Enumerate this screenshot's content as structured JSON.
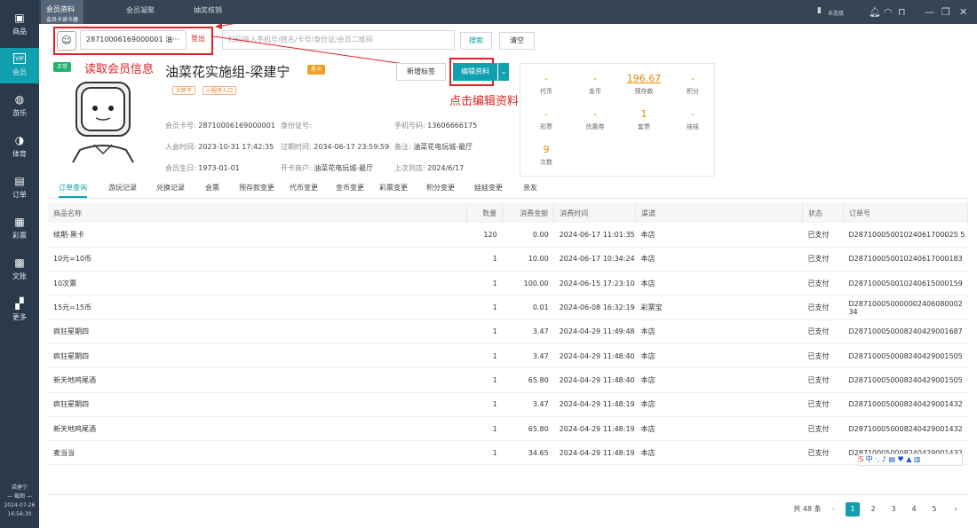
{
  "sidebar": {
    "items": [
      {
        "icon": "▣",
        "label": "商品",
        "name": "sidebar-item-goods"
      },
      {
        "icon": "VIP",
        "label": "会员",
        "name": "sidebar-item-member",
        "active": true
      },
      {
        "icon": "◍",
        "label": "游乐",
        "name": "sidebar-item-amusement"
      },
      {
        "icon": "◑",
        "label": "体育",
        "name": "sidebar-item-sports"
      },
      {
        "icon": "▤",
        "label": "订单",
        "name": "sidebar-item-orders"
      },
      {
        "icon": "▦",
        "label": "彩票",
        "name": "sidebar-item-lottery"
      },
      {
        "icon": "▩",
        "label": "文账",
        "name": "sidebar-item-accounts"
      },
      {
        "icon": "▞",
        "label": "更多",
        "name": "sidebar-item-more"
      }
    ],
    "user": "梁建宁",
    "divider": "— 截图 —",
    "date": "2024-07-26",
    "time": "16:56:30"
  },
  "topbar": {
    "tabs": [
      {
        "label": "会员资料",
        "sub": "会员卡读卡器"
      },
      {
        "label": "会员凝聚"
      },
      {
        "label": "抽奖核销"
      }
    ],
    "connection": "未连接"
  },
  "card_reader": {
    "card_value": "28710006169000001 油···",
    "logout": "登出"
  },
  "search": {
    "placeholder": "扫码输入手机号/姓名/卡号/身份证/会员二维码",
    "search_btn": "搜索",
    "clear_btn": "清空"
  },
  "annotations": {
    "read_member": "读取会员信息",
    "click_edit": "点击编辑资料"
  },
  "member": {
    "status": "正常",
    "name": "油菜花实施组-梁建宁",
    "level": "黑卡",
    "tags": [
      "大胖子",
      "小程序入口"
    ],
    "fields": [
      {
        "k": "会员卡号:",
        "v": "28710006169000001"
      },
      {
        "k": "身份证号:",
        "v": ""
      },
      {
        "k": "手机号码:",
        "v": "13606666175"
      },
      {
        "k": "入会时间:",
        "v": "2023-10-31 17:42:35"
      },
      {
        "k": "过期时间:",
        "v": "2034-06-17 23:59:59"
      },
      {
        "k": "备注:",
        "v": "油菜花电玩城-最厅"
      },
      {
        "k": "会员生日:",
        "v": "1973-01-01"
      },
      {
        "k": "开卡商户:",
        "v": "油菜花电玩城-最厅"
      },
      {
        "k": "上次到店:",
        "v": "2024/6/17"
      }
    ]
  },
  "actions": {
    "add_tag": "新增标签",
    "edit": "编辑资料",
    "dropdown": "⌄"
  },
  "stats": [
    {
      "v": "-",
      "l": "代币"
    },
    {
      "v": "-",
      "l": "金币"
    },
    {
      "v": "196.67",
      "l": "预存款",
      "u": true
    },
    {
      "v": "-",
      "l": "积分"
    },
    {
      "v": "-",
      "l": "彩票"
    },
    {
      "v": "-",
      "l": "优惠券"
    },
    {
      "v": "1",
      "l": "套票"
    },
    {
      "v": "-",
      "l": "娃娃"
    },
    {
      "v": "9",
      "l": "次数"
    }
  ],
  "tabs": [
    "订单查询",
    "游玩记录",
    "兑换记录",
    "会票",
    "预存款变更",
    "代币变更",
    "金币变更",
    "彩票变更",
    "积分变更",
    "娃娃变更",
    "亲友"
  ],
  "table": {
    "headers": [
      "商品名称",
      "数量",
      "消费金额",
      "消费时间",
      "渠道",
      "状态",
      "订单号"
    ],
    "rows": [
      [
        "续期-黑卡",
        "120",
        "0.00",
        "2024-06-17 11:01:35",
        "本店",
        "已支付",
        "D28710005001024061700025 5"
      ],
      [
        "10元=10币",
        "1",
        "10.00",
        "2024-06-17 10:34:24",
        "本店",
        "已支付",
        "D287100050010240617000183"
      ],
      [
        "10次票",
        "1",
        "100.00",
        "2024-06-15 17:23:10",
        "本店",
        "已支付",
        "D287100050010240615000159"
      ],
      [
        "15元=15币",
        "1",
        "0.01",
        "2024-06-08 16:32:19",
        "彩票宝",
        "已支付",
        "D287100050000002406080002 34"
      ],
      [
        "疯狂星期四",
        "1",
        "3.47",
        "2024-04-29 11:49:48",
        "本店",
        "已支付",
        "D287100050008240429001687"
      ],
      [
        "疯狂星期四",
        "1",
        "3.47",
        "2024-04-29 11:48:40",
        "本店",
        "已支付",
        "D287100050008240429001505"
      ],
      [
        "新天地鸡尾酒",
        "1",
        "65.80",
        "2024-04-29 11:48:40",
        "本店",
        "已支付",
        "D287100050008240429001505"
      ],
      [
        "疯狂星期四",
        "1",
        "3.47",
        "2024-04-29 11:48:19",
        "本店",
        "已支付",
        "D287100050008240429001432"
      ],
      [
        "新天地鸡尾酒",
        "1",
        "65.80",
        "2024-04-29 11:48:19",
        "本店",
        "已支付",
        "D287100050008240429001432"
      ],
      [
        "麦当当",
        "1",
        "34.65",
        "2024-04-29 11:48:19",
        "本店",
        "已支付",
        "D287100050008240429001432"
      ]
    ]
  },
  "pagination": {
    "total": "共 48 条",
    "pages": [
      "1",
      "2",
      "3",
      "4",
      "5"
    ],
    "prev": "‹",
    "next": "›"
  }
}
